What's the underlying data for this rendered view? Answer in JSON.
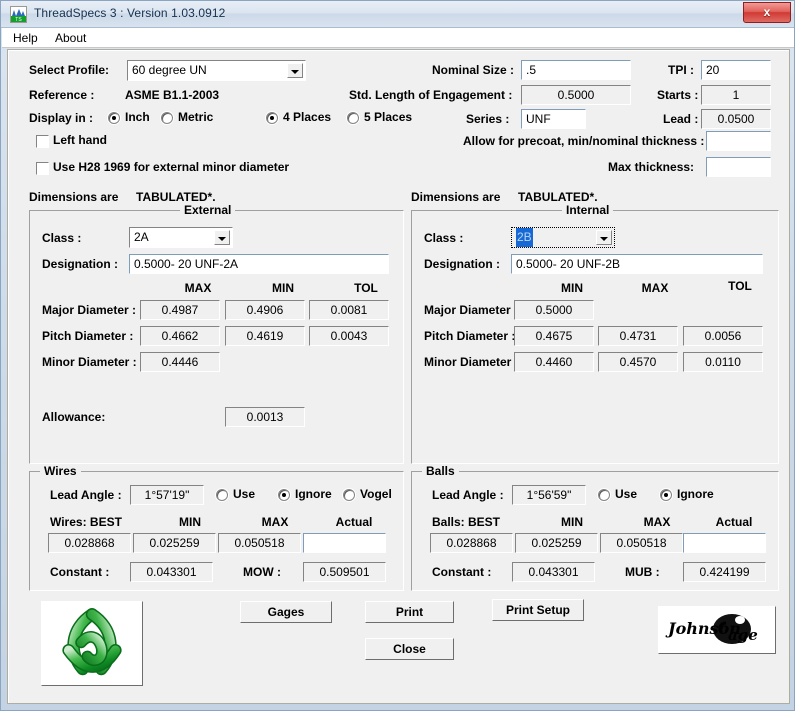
{
  "window": {
    "title": "ThreadSpecs 3 : Version 1.03.0912",
    "app_icon": "threadspecs-icon",
    "close_label": "x"
  },
  "menu": {
    "items": [
      {
        "label": "Help"
      },
      {
        "label": "About"
      }
    ]
  },
  "top_form": {
    "select_profile_label": "Select Profile:",
    "select_profile_value": "60 degree UN",
    "reference_label": "Reference :",
    "reference_value": "ASME B1.1-2003",
    "display_in_label": "Display in :",
    "unit_options": [
      {
        "label": "Inch",
        "selected": true
      },
      {
        "label": "Metric",
        "selected": false
      }
    ],
    "places_options": [
      {
        "label": "4 Places",
        "selected": true
      },
      {
        "label": "5 Places",
        "selected": false
      }
    ],
    "left_hand_label": "Left hand",
    "left_hand_checked": false,
    "h28_label": "Use H28 1969 for external minor diameter",
    "h28_checked": false,
    "nominal_size_label": "Nominal Size :",
    "nominal_size_value": ".5",
    "tpi_label": "TPI :",
    "tpi_value": "20",
    "std_length_label": "Std. Length of Engagement :",
    "std_length_value": "0.5000",
    "starts_label": "Starts :",
    "starts_value": "1",
    "series_label": "Series :",
    "series_value": "UNF",
    "lead_label": "Lead :",
    "lead_value": "0.0500",
    "precoat_label": "Allow for precoat, min/nominal thickness :",
    "precoat_value": "",
    "max_thickness_label": "Max thickness:",
    "max_thickness_value": ""
  },
  "external": {
    "dimensions_are_label": "Dimensions are",
    "dimensions_are_value": "TABULATED*.",
    "group_title": "External",
    "class_label": "Class :",
    "class_value": "2A",
    "designation_label": "Designation :",
    "designation_value": "0.5000- 20 UNF-2A",
    "columns": [
      "MAX",
      "MIN",
      "TOL"
    ],
    "rows": [
      {
        "label": "Major Diameter :",
        "values": [
          "0.4987",
          "0.4906",
          "0.0081"
        ]
      },
      {
        "label": "Pitch Diameter :",
        "values": [
          "0.4662",
          "0.4619",
          "0.0043"
        ]
      },
      {
        "label": "Minor Diameter :",
        "values": [
          "0.4446",
          "",
          ""
        ]
      }
    ],
    "allowance_label": "Allowance:",
    "allowance_value": "0.0013"
  },
  "internal": {
    "dimensions_are_label": "Dimensions are",
    "dimensions_are_value": "TABULATED*.",
    "group_title": "Internal",
    "class_label": "Class :",
    "class_value": "2B",
    "class_focused": true,
    "designation_label": "Designation :",
    "designation_value": "0.5000- 20 UNF-2B",
    "columns": [
      "MIN",
      "MAX",
      "TOL"
    ],
    "rows": [
      {
        "label": "Major Diameter :",
        "values": [
          "0.5000",
          "",
          ""
        ]
      },
      {
        "label": "Pitch Diameter :",
        "values": [
          "0.4675",
          "0.4731",
          "0.0056"
        ]
      },
      {
        "label": "Minor Diameter :",
        "values": [
          "0.4460",
          "0.4570",
          "0.0110"
        ]
      }
    ]
  },
  "wires": {
    "group_title": "Wires",
    "lead_angle_label": "Lead Angle :",
    "lead_angle_value": "1°57'19\"",
    "modes": [
      {
        "label": "Use",
        "selected": false
      },
      {
        "label": "Ignore",
        "selected": true
      },
      {
        "label": "Vogel",
        "selected": false
      }
    ],
    "columns": [
      "Wires: BEST",
      "MIN",
      "MAX",
      "Actual"
    ],
    "values": [
      "0.028868",
      "0.025259",
      "0.050518",
      ""
    ],
    "constant_label": "Constant :",
    "constant_value": "0.043301",
    "result_label": "MOW :",
    "result_value": "0.509501"
  },
  "balls": {
    "group_title": "Balls",
    "lead_angle_label": "Lead Angle :",
    "lead_angle_value": "1°56'59\"",
    "modes": [
      {
        "label": "Use",
        "selected": false
      },
      {
        "label": "Ignore",
        "selected": true
      }
    ],
    "columns": [
      "Balls: BEST",
      "MIN",
      "MAX",
      "Actual"
    ],
    "values": [
      "0.028868",
      "0.025259",
      "0.050518",
      ""
    ],
    "constant_label": "Constant :",
    "constant_value": "0.043301",
    "result_label": "MUB :",
    "result_value": "0.424199"
  },
  "buttons": {
    "gages": "Gages",
    "print": "Print",
    "print_setup": "Print Setup",
    "close": "Close"
  },
  "logos": {
    "left": "trefoil-knot-logo",
    "right_text": "Johnson",
    "right_text2": "Gage"
  },
  "colors": {
    "accent_blue": "#1669d4",
    "logo_green": "#189c2e",
    "close_red": "#cf3a33",
    "dialog_bg": "#f0f0f0"
  }
}
